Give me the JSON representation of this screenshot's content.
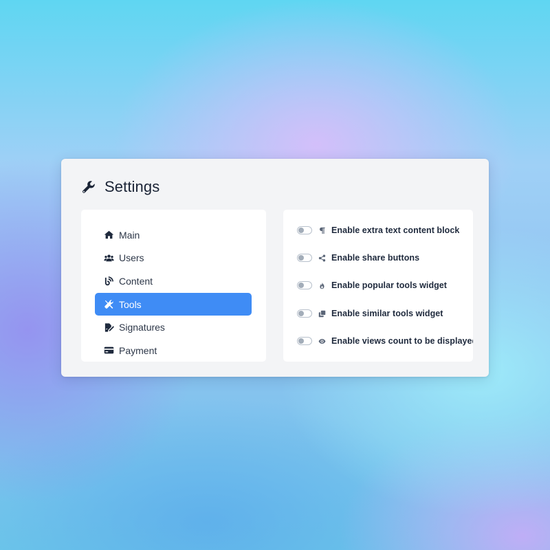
{
  "header": {
    "title": "Settings",
    "icon": "wrench-icon"
  },
  "nav": {
    "items": [
      {
        "label": "Main",
        "icon": "home-icon",
        "active": false
      },
      {
        "label": "Users",
        "icon": "users-icon",
        "active": false
      },
      {
        "label": "Content",
        "icon": "feed-icon",
        "active": false
      },
      {
        "label": "Tools",
        "icon": "tools-icon",
        "active": true
      },
      {
        "label": "Signatures",
        "icon": "signature-icon",
        "active": false
      },
      {
        "label": "Payment",
        "icon": "credit-card-icon",
        "active": false
      }
    ],
    "active_color": "#3f8cf5"
  },
  "options": {
    "items": [
      {
        "label": "Enable extra text content block",
        "icon": "paragraph-icon",
        "enabled": false
      },
      {
        "label": "Enable share buttons",
        "icon": "share-icon",
        "enabled": false
      },
      {
        "label": "Enable popular tools widget",
        "icon": "fire-icon",
        "enabled": false
      },
      {
        "label": "Enable similar tools widget",
        "icon": "clone-icon",
        "enabled": false
      },
      {
        "label": "Enable views count to be displayed",
        "icon": "eye-icon",
        "enabled": false
      }
    ]
  }
}
